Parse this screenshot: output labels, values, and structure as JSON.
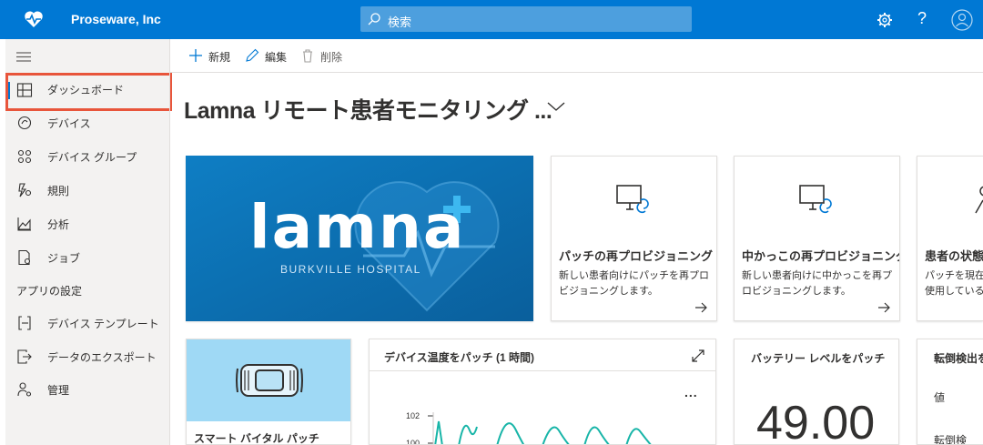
{
  "header": {
    "brand": "Proseware, Inc",
    "search_placeholder": "検索",
    "icons": [
      "heart-pulse-icon",
      "search-icon",
      "gear-icon",
      "help-icon",
      "account-icon"
    ]
  },
  "sidebar": {
    "items": [
      {
        "label": "ダッシュボード",
        "icon": "dashboard-icon",
        "active": true
      },
      {
        "label": "デバイス",
        "icon": "device-icon"
      },
      {
        "label": "デバイス グループ",
        "icon": "device-group-icon"
      },
      {
        "label": "規則",
        "icon": "rules-icon"
      },
      {
        "label": "分析",
        "icon": "analytics-icon"
      },
      {
        "label": "ジョブ",
        "icon": "jobs-icon"
      }
    ],
    "section_label": "アプリの設定",
    "settings_items": [
      {
        "label": "デバイス テンプレート",
        "icon": "device-template-icon"
      },
      {
        "label": "データのエクスポート",
        "icon": "export-icon"
      },
      {
        "label": "管理",
        "icon": "admin-icon"
      }
    ]
  },
  "commands": {
    "new": "新規",
    "edit": "編集",
    "delete": "削除"
  },
  "dashboard": {
    "title": "Lamna リモート患者モニタリング ...",
    "hero": {
      "logo_text": "lamna",
      "subtitle": "BURKVILLE HOSPITAL"
    },
    "link_tiles": [
      {
        "title": "パッチの再プロビジョニング",
        "description": "新しい患者向けにパッチを再プロビジョニングします。"
      },
      {
        "title": "中かっこの再プロビジョニング",
        "description": "新しい患者向けに中かっこを再プロビジョニングします。"
      },
      {
        "title": "患者の状態",
        "description": "パッチを現在使用しているか"
      }
    ],
    "patch_tile": {
      "label": "スマート バイタル パッチ"
    },
    "temperature_chart": {
      "title": "デバイス温度をパッチ (1 時間)",
      "more": "...",
      "y_ticks": [
        "102",
        "100"
      ]
    },
    "battery_tile": {
      "title": "バッテリー レベルをパッチ",
      "value": "49.00"
    },
    "fall_tile": {
      "title": "転倒検出を",
      "row1": "値",
      "row2": "転倒検"
    }
  },
  "colors": {
    "header": "#0078d4",
    "sidebar": "#f3f2f1",
    "highlight": "#e8553b",
    "accent": "#0078d4",
    "chart_line": "#18b5a8"
  }
}
